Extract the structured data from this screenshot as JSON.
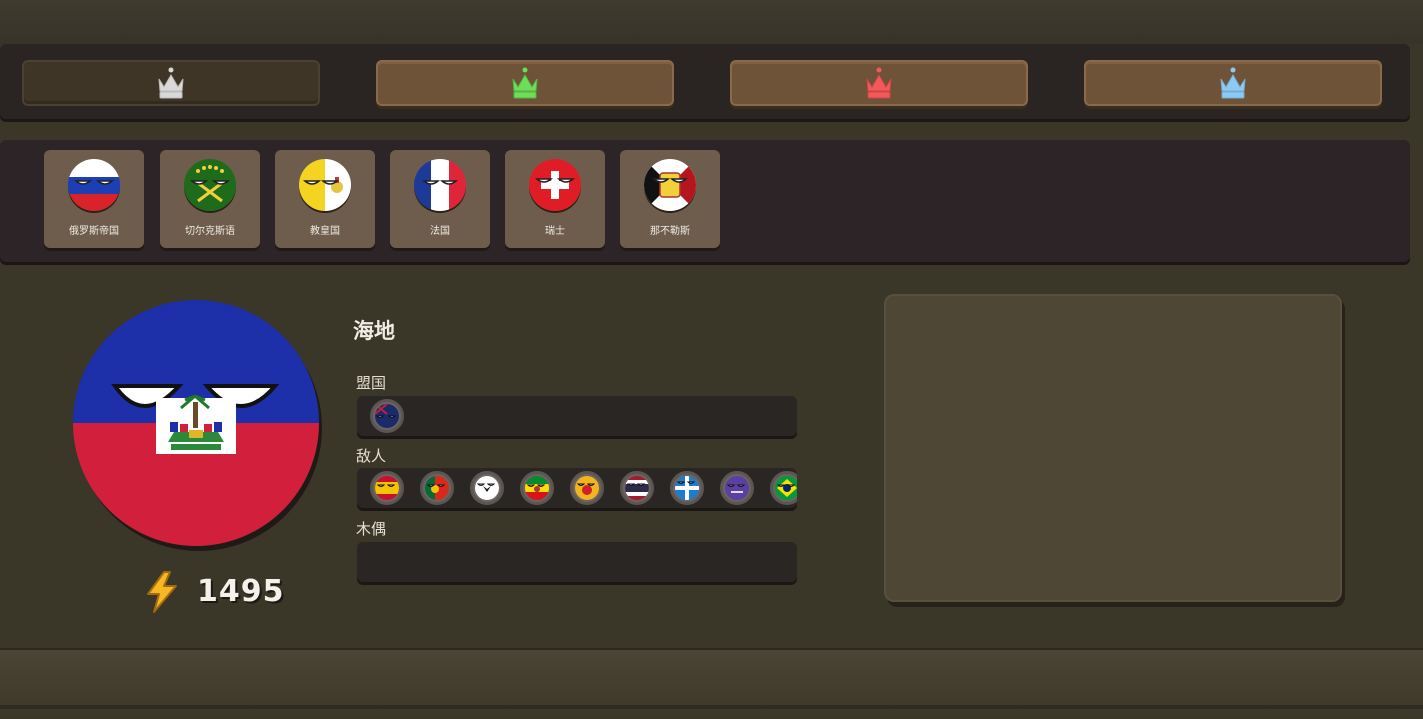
{
  "tabs": [
    {
      "id": "white",
      "icon": "crown-white-icon",
      "color": "#d9d9d9",
      "active": true
    },
    {
      "id": "green",
      "icon": "crown-green-icon",
      "color": "#6fdc5a",
      "active": false
    },
    {
      "id": "red",
      "icon": "crown-red-icon",
      "color": "#f05a5a",
      "active": false
    },
    {
      "id": "blue",
      "icon": "crown-blue-icon",
      "color": "#8ec9f2",
      "active": false
    }
  ],
  "nations": [
    {
      "name": "俄罗斯帝国",
      "flag": "russia"
    },
    {
      "name": "切尔克斯语",
      "flag": "circassia"
    },
    {
      "name": "教皇国",
      "flag": "papal"
    },
    {
      "name": "法国",
      "flag": "france"
    },
    {
      "name": "瑞士",
      "flag": "switzerland"
    },
    {
      "name": "那不勒斯",
      "flag": "naples"
    }
  ],
  "selected": {
    "name": "海地",
    "energy": "1495",
    "allies_label": "盟国",
    "enemies_label": "敌人",
    "puppets_label": "木偶",
    "allies": [
      "new-zealand"
    ],
    "enemies": [
      "spain",
      "portugal",
      "prussia",
      "ethiopia",
      "japan-sun",
      "thailand",
      "quebec",
      "purple",
      "brazil"
    ],
    "puppets": []
  }
}
